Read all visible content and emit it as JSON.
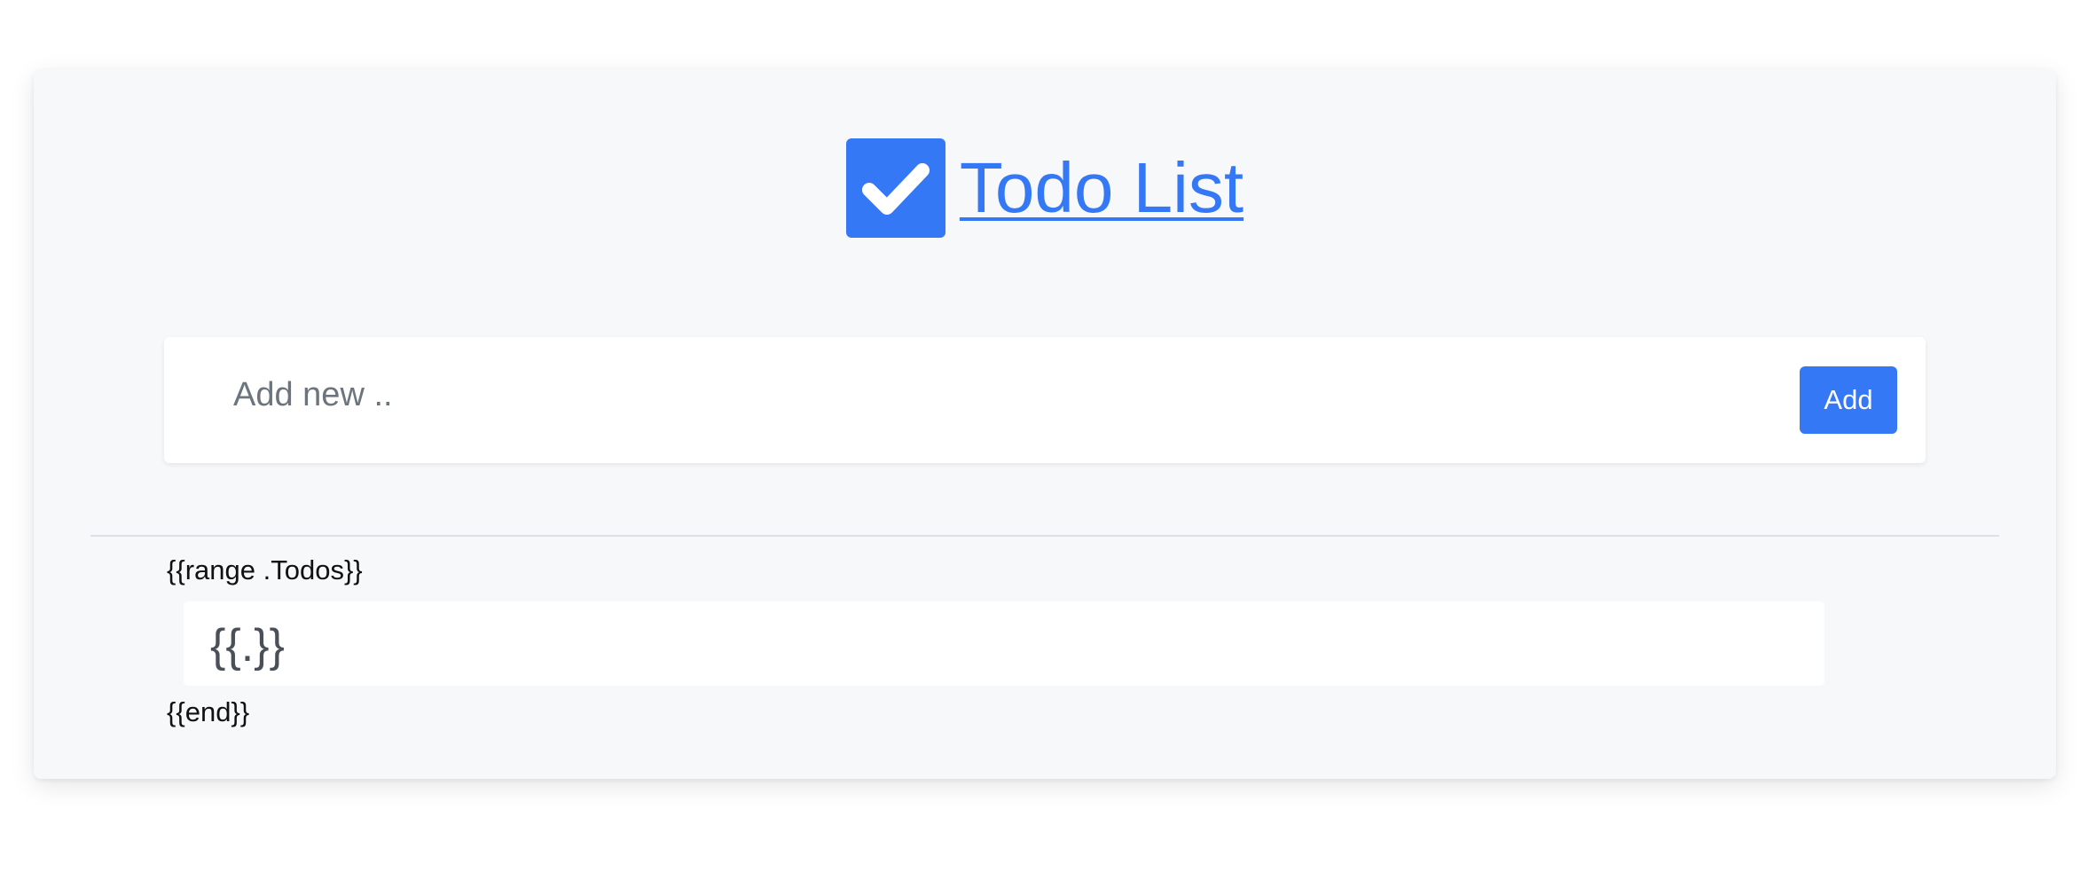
{
  "header": {
    "title": "Todo List",
    "logo_icon": "checkbox-check-icon"
  },
  "form": {
    "placeholder": "Add new ..",
    "value": "",
    "add_label": "Add"
  },
  "list": {
    "range_start": "{{range .Todos}}",
    "items": [
      {
        "text": "{{.}}"
      }
    ],
    "range_end": "{{end}}"
  },
  "colors": {
    "accent": "#3478f6",
    "card_background": "#f7f8fa",
    "item_text": "#495057",
    "placeholder": "#6c757d"
  }
}
